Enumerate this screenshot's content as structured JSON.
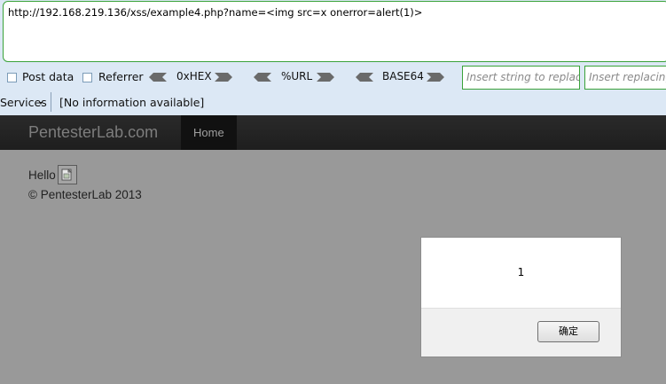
{
  "hackbar": {
    "url": "http://192.168.219.136/xss/example4.php?name=<img src=x onerror=alert(1)>",
    "post_data_label": "Post data",
    "referrer_label": "Referrer",
    "hex_label": "0xHEX",
    "url_label": "%URL",
    "base64_label": "BASE64",
    "replace_placeholder": "Insert string to replace",
    "replacing_placeholder": "Insert replacing string"
  },
  "info_bar": {
    "services_label": "Services",
    "info_text": "[No information available]"
  },
  "site": {
    "brand": "PentesterLab.com",
    "nav_home": "Home",
    "hello": "Hello",
    "copyright": "© PentesterLab 2013"
  },
  "alert": {
    "message": "1",
    "ok_label": "确定"
  }
}
